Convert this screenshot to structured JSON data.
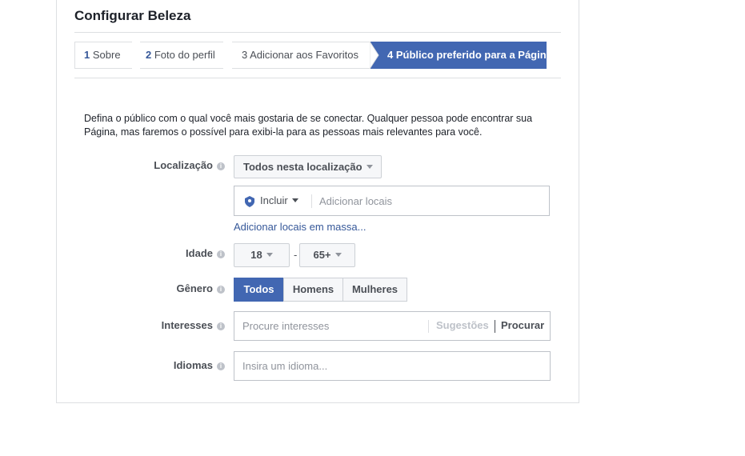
{
  "page": {
    "title": "Configurar Beleza"
  },
  "steps": [
    {
      "num": "1",
      "label": "Sobre"
    },
    {
      "num": "2",
      "label": "Foto do perfil"
    },
    {
      "num": "3",
      "label": "Adicionar aos Favoritos"
    },
    {
      "num": "4",
      "label": "Público preferido para a Página"
    }
  ],
  "description": "Defina o público com o qual você mais gostaria de se conectar. Qualquer pessoa pode encontrar sua Página, mas faremos o possível para exibi-la para as pessoas mais relevantes para você.",
  "location": {
    "label": "Localização",
    "dropdown": "Todos nesta localização",
    "include": "Incluir",
    "placeholder": "Adicionar locais",
    "bulk_link": "Adicionar locais em massa..."
  },
  "age": {
    "label": "Idade",
    "min": "18",
    "separator": "-",
    "max": "65+"
  },
  "gender": {
    "label": "Gênero",
    "options": [
      "Todos",
      "Homens",
      "Mulheres"
    ],
    "selected": "Todos"
  },
  "interests": {
    "label": "Interesses",
    "placeholder": "Procure interesses",
    "suggestions": "Sugestões",
    "browse": "Procurar"
  },
  "languages": {
    "label": "Idiomas",
    "placeholder": "Insira um idioma..."
  },
  "colors": {
    "accent": "#4267b2",
    "link": "#365899",
    "border": "#dddfe2"
  }
}
